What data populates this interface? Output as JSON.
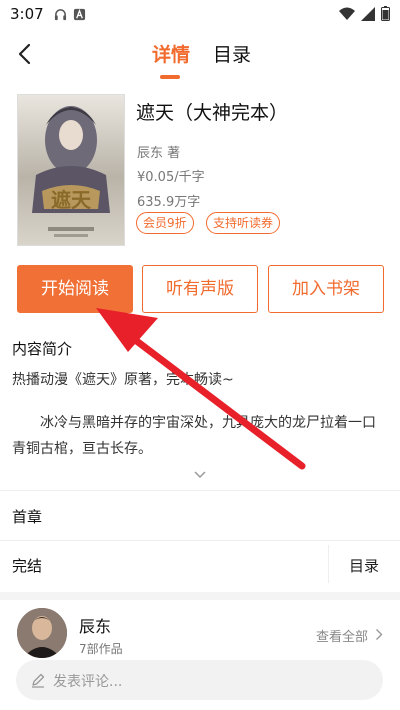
{
  "status_bar": {
    "time": "3:07"
  },
  "nav": {
    "tabs": [
      {
        "label": "详情",
        "active": true
      },
      {
        "label": "目录",
        "active": false
      }
    ]
  },
  "book": {
    "title": "遮天（大神完本）",
    "author": "辰东 著",
    "price": "¥0.05/千字",
    "word_count": "635.9万字",
    "badges": [
      "会员9折",
      "支持听读券"
    ]
  },
  "actions": {
    "read": "开始阅读",
    "audio": "听有声版",
    "shelf": "加入书架"
  },
  "intro": {
    "heading": "内容简介",
    "tagline": "热播动漫《遮天》原著，完本畅读~",
    "body": "冰冷与黑暗并存的宇宙深处，九具庞大的龙尸拉着一口青铜古棺，亘古长存。"
  },
  "chapters": {
    "first_label": "首章",
    "status_label": "完结",
    "toc_label": "目录"
  },
  "author": {
    "name": "辰东",
    "works": "7部作品",
    "view_all": "查看全部"
  },
  "comment": {
    "placeholder": "发表评论..."
  },
  "colors": {
    "accent": "#f26b2e",
    "annotation": "#e8202a"
  }
}
